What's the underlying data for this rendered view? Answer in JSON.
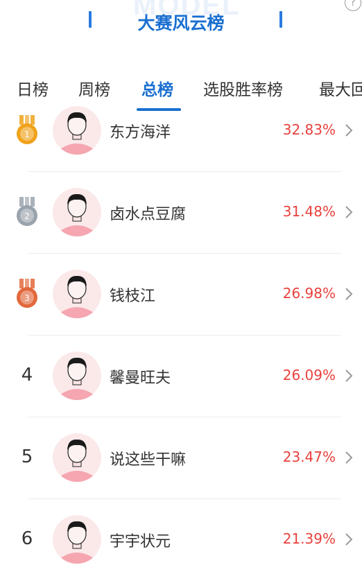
{
  "header": {
    "background_word": "MODEL",
    "title": "大赛风云榜",
    "help_icon": "question-circle-icon"
  },
  "tabs": [
    {
      "label": "日榜",
      "active": false
    },
    {
      "label": "周榜",
      "active": false
    },
    {
      "label": "总榜",
      "active": true
    },
    {
      "label": "选股胜率榜",
      "active": false
    },
    {
      "label": "最大回",
      "active": false
    }
  ],
  "colors": {
    "accent": "#1a6fd1",
    "percent": "#e8413d",
    "gold": "#f0a21b",
    "silver": "#9aa3ad",
    "bronze": "#e2683b"
  },
  "rankings": [
    {
      "rank": "1",
      "medal": "gold",
      "name": "东方海洋",
      "rate": "32.83%"
    },
    {
      "rank": "2",
      "medal": "silver",
      "name": "卤水点豆腐",
      "rate": "31.48%"
    },
    {
      "rank": "3",
      "medal": "bronze",
      "name": "钱枝江",
      "rate": "26.98%"
    },
    {
      "rank": "4",
      "medal": null,
      "name": "馨曼旺夫",
      "rate": "26.09%"
    },
    {
      "rank": "5",
      "medal": null,
      "name": "说这些干嘛",
      "rate": "23.47%"
    },
    {
      "rank": "6",
      "medal": null,
      "name": "宇宇状元",
      "rate": "21.39%"
    }
  ]
}
